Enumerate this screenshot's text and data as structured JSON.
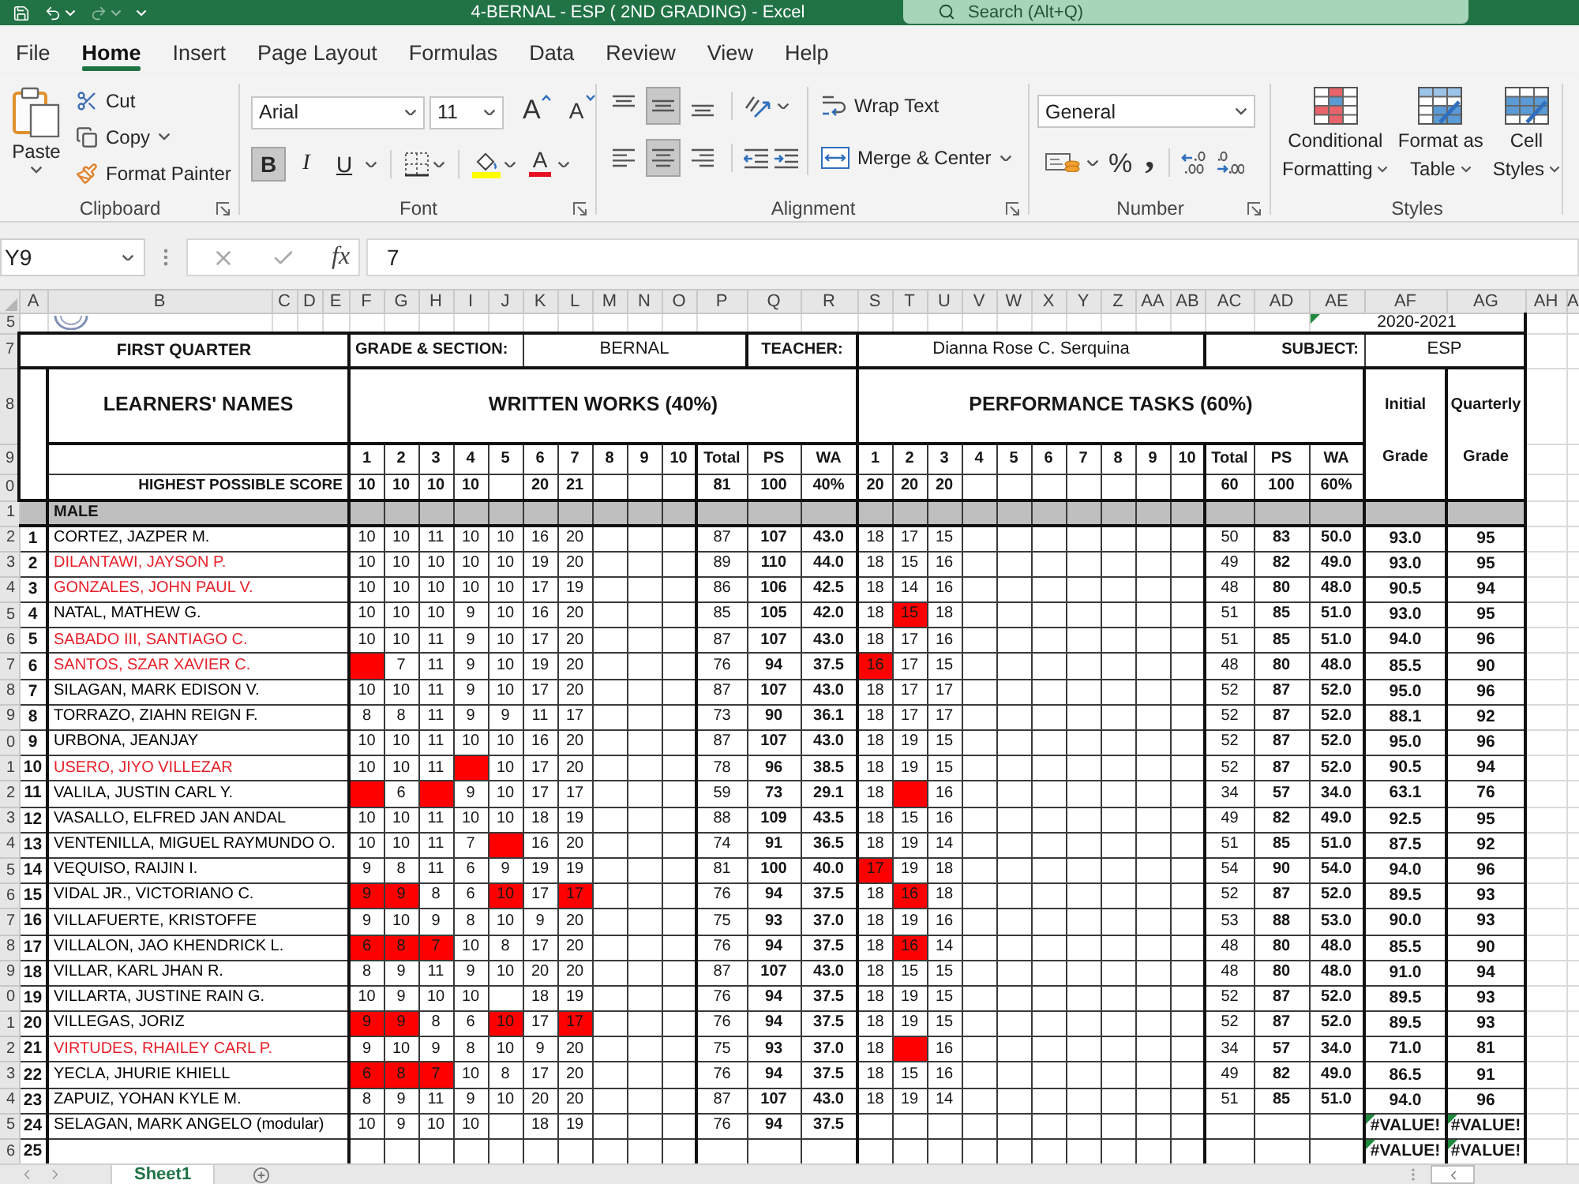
{
  "window": {
    "title": "4-BERNAL - ESP ( 2ND GRADING) - Excel",
    "search": {
      "placeholder": "Search (Alt+Q)"
    }
  },
  "tabs": [
    {
      "label": "File",
      "selected": false
    },
    {
      "label": "Home",
      "selected": true
    },
    {
      "label": "Insert",
      "selected": false
    },
    {
      "label": "Page Layout",
      "selected": false
    },
    {
      "label": "Formulas",
      "selected": false
    },
    {
      "label": "Data",
      "selected": false
    },
    {
      "label": "Review",
      "selected": false
    },
    {
      "label": "View",
      "selected": false
    },
    {
      "label": "Help",
      "selected": false
    }
  ],
  "ribbon": {
    "clipboard": {
      "paste": "Paste",
      "cut": "Cut",
      "copy": "Copy",
      "format_painter": "Format Painter",
      "label": "Clipboard"
    },
    "font": {
      "font_name": "Arial",
      "font_size": "11",
      "grow_font": "A",
      "shrink_font": "A",
      "styles": [
        {
          "kind": "bold",
          "label": "B",
          "selected": true
        },
        {
          "kind": "italic",
          "label": "I",
          "selected": false
        },
        {
          "kind": "underline",
          "label": "U",
          "selected": false
        }
      ],
      "font_color": "A",
      "label": "Font"
    },
    "alignment": {
      "vertical": [
        {
          "kind": "top",
          "selected": false
        },
        {
          "kind": "middle",
          "selected": true
        },
        {
          "kind": "bottom",
          "selected": false
        }
      ],
      "horizontal": [
        {
          "kind": "left",
          "selected": false
        },
        {
          "kind": "center",
          "selected": true
        },
        {
          "kind": "right",
          "selected": false
        }
      ],
      "wrap_text": "Wrap Text",
      "merge_center": "Merge & Center",
      "label": "Alignment"
    },
    "number": {
      "format": "General",
      "percent": "%",
      "comma": ",",
      "label": "Number"
    },
    "styles": {
      "buttons": [
        {
          "kind": "conditional",
          "label": "Conditional Formatting"
        },
        {
          "kind": "table",
          "label": "Format as Table"
        },
        {
          "kind": "cell",
          "label": "Cell Styles"
        }
      ],
      "label": "Styles"
    }
  },
  "formula_bar": {
    "name_box": "Y9",
    "function_label": "fx",
    "formula": "7"
  },
  "sheet": {
    "column_headers": [
      "A",
      "B",
      "C",
      "D",
      "E",
      "F",
      "G",
      "H",
      "I",
      "J",
      "K",
      "L",
      "M",
      "N",
      "O",
      "P",
      "Q",
      "R",
      "S",
      "T",
      "U",
      "V",
      "W",
      "X",
      "Y",
      "Z",
      "AA",
      "AB",
      "AC",
      "AD",
      "AE",
      "AF",
      "AG",
      "AH",
      "A"
    ],
    "row_headers": [
      "5",
      "7",
      "8",
      "9",
      "0",
      "1",
      "2",
      "3",
      "4",
      "5",
      "6",
      "7",
      "8",
      "9",
      "0",
      "1",
      "2",
      "3",
      "4",
      "5",
      "6",
      "7",
      "8",
      "9",
      "0",
      "1",
      "2",
      "3",
      "4",
      "5",
      "6"
    ],
    "school_year": {
      "text": "2020-2021",
      "warning": true
    },
    "quarter": "FIRST QUARTER",
    "grade_section_label": "GRADE & SECTION:",
    "grade_section": "BERNAL",
    "teacher_label": "TEACHER:",
    "teacher": "Dianna Rose C. Serquina",
    "subject_label": "SUBJECT:",
    "subject": "ESP",
    "names_heading": "LEARNERS' NAMES",
    "written": {
      "heading": "WRITTEN WORKS (40%)",
      "items": [
        {
          "label": "1",
          "hps": "10"
        },
        {
          "label": "2",
          "hps": "10"
        },
        {
          "label": "3",
          "hps": "10"
        },
        {
          "label": "4",
          "hps": "10"
        },
        {
          "label": "5"
        },
        {
          "label": "6",
          "hps": "20"
        },
        {
          "label": "7",
          "hps": "21"
        },
        {
          "label": "8"
        },
        {
          "label": "9"
        },
        {
          "label": "10"
        }
      ],
      "summary": [
        "Total",
        "PS",
        "WA"
      ],
      "hps_summary": [
        "81",
        "100",
        "40%"
      ]
    },
    "performance": {
      "heading": "PERFORMANCE TASKS (60%)",
      "items": [
        {
          "label": "1",
          "hps": "20"
        },
        {
          "label": "2",
          "hps": "20"
        },
        {
          "label": "3",
          "hps": "20"
        },
        {
          "label": "4"
        },
        {
          "label": "5"
        },
        {
          "label": "6"
        },
        {
          "label": "7"
        },
        {
          "label": "8"
        },
        {
          "label": "9"
        },
        {
          "label": "10"
        }
      ],
      "summary": [
        "Total",
        "PS",
        "WA"
      ],
      "hps_summary": [
        "60",
        "100",
        "60%"
      ]
    },
    "initial_heading": {
      "top": "Initial",
      "bottom": "Grade"
    },
    "quarterly_heading": {
      "top": "Quarterly",
      "bottom": "Grade"
    },
    "hps_label": "HIGHEST POSSIBLE SCORE",
    "section": "MALE",
    "learners": [
      {
        "no": "1",
        "name": "CORTEZ, JAZPER M.",
        "color": "#000000",
        "written": [
          {
            "score": "10",
            "marked": false
          },
          {
            "score": "10",
            "marked": false
          },
          {
            "score": "11",
            "marked": false
          },
          {
            "score": "10",
            "marked": false
          },
          {
            "score": "10",
            "marked": false
          },
          {
            "score": "16",
            "marked": false
          },
          {
            "score": "20",
            "marked": false
          }
        ],
        "written_summary": [
          "87",
          "107",
          "43.0"
        ],
        "performance": [
          {
            "score": "18",
            "marked": false
          },
          {
            "score": "17",
            "marked": false
          },
          {
            "score": "15",
            "marked": false
          }
        ],
        "performance_summary": [
          "50",
          "83",
          "50.0"
        ],
        "initial": "93.0",
        "quarterly": "95",
        "warning": false
      },
      {
        "no": "2",
        "name": "DILANTAWI, JAYSON P.",
        "color": "#e8202a",
        "written": [
          {
            "score": "10",
            "marked": false
          },
          {
            "score": "10",
            "marked": false
          },
          {
            "score": "10",
            "marked": false
          },
          {
            "score": "10",
            "marked": false
          },
          {
            "score": "10",
            "marked": false
          },
          {
            "score": "19",
            "marked": false
          },
          {
            "score": "20",
            "marked": false
          }
        ],
        "written_summary": [
          "89",
          "110",
          "44.0"
        ],
        "performance": [
          {
            "score": "18",
            "marked": false
          },
          {
            "score": "15",
            "marked": false
          },
          {
            "score": "16",
            "marked": false
          }
        ],
        "performance_summary": [
          "49",
          "82",
          "49.0"
        ],
        "initial": "93.0",
        "quarterly": "95",
        "warning": false
      },
      {
        "no": "3",
        "name": "GONZALES, JOHN PAUL V.",
        "color": "#e8202a",
        "written": [
          {
            "score": "10",
            "marked": false
          },
          {
            "score": "10",
            "marked": false
          },
          {
            "score": "10",
            "marked": false
          },
          {
            "score": "10",
            "marked": false
          },
          {
            "score": "10",
            "marked": false
          },
          {
            "score": "17",
            "marked": false
          },
          {
            "score": "19",
            "marked": false
          }
        ],
        "written_summary": [
          "86",
          "106",
          "42.5"
        ],
        "performance": [
          {
            "score": "18",
            "marked": false
          },
          {
            "score": "14",
            "marked": false
          },
          {
            "score": "16",
            "marked": false
          }
        ],
        "performance_summary": [
          "48",
          "80",
          "48.0"
        ],
        "initial": "90.5",
        "quarterly": "94",
        "warning": false
      },
      {
        "no": "4",
        "name": "NATAL, MATHEW G.",
        "color": "#000000",
        "written": [
          {
            "score": "10",
            "marked": false
          },
          {
            "score": "10",
            "marked": false
          },
          {
            "score": "10",
            "marked": false
          },
          {
            "score": "9",
            "marked": false
          },
          {
            "score": "10",
            "marked": false
          },
          {
            "score": "16",
            "marked": false
          },
          {
            "score": "20",
            "marked": false
          }
        ],
        "written_summary": [
          "85",
          "105",
          "42.0"
        ],
        "performance": [
          {
            "score": "18",
            "marked": false
          },
          {
            "score": "15",
            "marked": true
          },
          {
            "score": "18",
            "marked": false
          }
        ],
        "performance_summary": [
          "51",
          "85",
          "51.0"
        ],
        "initial": "93.0",
        "quarterly": "95",
        "warning": false
      },
      {
        "no": "5",
        "name": "SABADO III, SANTIAGO C.",
        "color": "#e8202a",
        "written": [
          {
            "score": "10",
            "marked": false
          },
          {
            "score": "10",
            "marked": false
          },
          {
            "score": "11",
            "marked": false
          },
          {
            "score": "9",
            "marked": false
          },
          {
            "score": "10",
            "marked": false
          },
          {
            "score": "17",
            "marked": false
          },
          {
            "score": "20",
            "marked": false
          }
        ],
        "written_summary": [
          "87",
          "107",
          "43.0"
        ],
        "performance": [
          {
            "score": "18",
            "marked": false
          },
          {
            "score": "17",
            "marked": false
          },
          {
            "score": "16",
            "marked": false
          }
        ],
        "performance_summary": [
          "51",
          "85",
          "51.0"
        ],
        "initial": "94.0",
        "quarterly": "96",
        "warning": false
      },
      {
        "no": "6",
        "name": "SANTOS, SZAR XAVIER C.",
        "color": "#e8202a",
        "written": [
          {
            "marked": true
          },
          {
            "score": "7",
            "marked": false
          },
          {
            "score": "11",
            "marked": false
          },
          {
            "score": "9",
            "marked": false
          },
          {
            "score": "10",
            "marked": false
          },
          {
            "score": "19",
            "marked": false
          },
          {
            "score": "20",
            "marked": false
          }
        ],
        "written_summary": [
          "76",
          "94",
          "37.5"
        ],
        "performance": [
          {
            "score": "16",
            "marked": true
          },
          {
            "score": "17",
            "marked": false
          },
          {
            "score": "15",
            "marked": false
          }
        ],
        "performance_summary": [
          "48",
          "80",
          "48.0"
        ],
        "initial": "85.5",
        "quarterly": "90",
        "warning": false
      },
      {
        "no": "7",
        "name": "SILAGAN, MARK EDISON V.",
        "color": "#000000",
        "written": [
          {
            "score": "10",
            "marked": false
          },
          {
            "score": "10",
            "marked": false
          },
          {
            "score": "11",
            "marked": false
          },
          {
            "score": "9",
            "marked": false
          },
          {
            "score": "10",
            "marked": false
          },
          {
            "score": "17",
            "marked": false
          },
          {
            "score": "20",
            "marked": false
          }
        ],
        "written_summary": [
          "87",
          "107",
          "43.0"
        ],
        "performance": [
          {
            "score": "18",
            "marked": false
          },
          {
            "score": "17",
            "marked": false
          },
          {
            "score": "17",
            "marked": false
          }
        ],
        "performance_summary": [
          "52",
          "87",
          "52.0"
        ],
        "initial": "95.0",
        "quarterly": "96",
        "warning": false
      },
      {
        "no": "8",
        "name": "TORRAZO, ZIAHN REIGN F.",
        "color": "#000000",
        "written": [
          {
            "score": "8",
            "marked": false
          },
          {
            "score": "8",
            "marked": false
          },
          {
            "score": "11",
            "marked": false
          },
          {
            "score": "9",
            "marked": false
          },
          {
            "score": "9",
            "marked": false
          },
          {
            "score": "11",
            "marked": false
          },
          {
            "score": "17",
            "marked": false
          }
        ],
        "written_summary": [
          "73",
          "90",
          "36.1"
        ],
        "performance": [
          {
            "score": "18",
            "marked": false
          },
          {
            "score": "17",
            "marked": false
          },
          {
            "score": "17",
            "marked": false
          }
        ],
        "performance_summary": [
          "52",
          "87",
          "52.0"
        ],
        "initial": "88.1",
        "quarterly": "92",
        "warning": false
      },
      {
        "no": "9",
        "name": "URBONA, JEANJAY",
        "color": "#000000",
        "written": [
          {
            "score": "10",
            "marked": false
          },
          {
            "score": "10",
            "marked": false
          },
          {
            "score": "11",
            "marked": false
          },
          {
            "score": "10",
            "marked": false
          },
          {
            "score": "10",
            "marked": false
          },
          {
            "score": "16",
            "marked": false
          },
          {
            "score": "20",
            "marked": false
          }
        ],
        "written_summary": [
          "87",
          "107",
          "43.0"
        ],
        "performance": [
          {
            "score": "18",
            "marked": false
          },
          {
            "score": "19",
            "marked": false
          },
          {
            "score": "15",
            "marked": false
          }
        ],
        "performance_summary": [
          "52",
          "87",
          "52.0"
        ],
        "initial": "95.0",
        "quarterly": "96",
        "warning": false
      },
      {
        "no": "10",
        "name": "USERO, JIYO VILLEZAR",
        "color": "#e8202a",
        "written": [
          {
            "score": "10",
            "marked": false
          },
          {
            "score": "10",
            "marked": false
          },
          {
            "score": "11",
            "marked": false
          },
          {
            "marked": true
          },
          {
            "score": "10",
            "marked": false
          },
          {
            "score": "17",
            "marked": false
          },
          {
            "score": "20",
            "marked": false
          }
        ],
        "written_summary": [
          "78",
          "96",
          "38.5"
        ],
        "performance": [
          {
            "score": "18",
            "marked": false
          },
          {
            "score": "19",
            "marked": false
          },
          {
            "score": "15",
            "marked": false
          }
        ],
        "performance_summary": [
          "52",
          "87",
          "52.0"
        ],
        "initial": "90.5",
        "quarterly": "94",
        "warning": false
      },
      {
        "no": "11",
        "name": "VALILA, JUSTIN CARL Y.",
        "color": "#000000",
        "written": [
          {
            "marked": true
          },
          {
            "score": "6",
            "marked": false
          },
          {
            "marked": true
          },
          {
            "score": "9",
            "marked": false
          },
          {
            "score": "10",
            "marked": false
          },
          {
            "score": "17",
            "marked": false
          },
          {
            "score": "17",
            "marked": false
          }
        ],
        "written_summary": [
          "59",
          "73",
          "29.1"
        ],
        "performance": [
          {
            "score": "18",
            "marked": false
          },
          {
            "marked": true
          },
          {
            "score": "16",
            "marked": false
          }
        ],
        "performance_summary": [
          "34",
          "57",
          "34.0"
        ],
        "initial": "63.1",
        "quarterly": "76",
        "warning": false
      },
      {
        "no": "12",
        "name": "VASALLO, ELFRED JAN ANDAL",
        "color": "#000000",
        "written": [
          {
            "score": "10",
            "marked": false
          },
          {
            "score": "10",
            "marked": false
          },
          {
            "score": "11",
            "marked": false
          },
          {
            "score": "10",
            "marked": false
          },
          {
            "score": "10",
            "marked": false
          },
          {
            "score": "18",
            "marked": false
          },
          {
            "score": "19",
            "marked": false
          }
        ],
        "written_summary": [
          "88",
          "109",
          "43.5"
        ],
        "performance": [
          {
            "score": "18",
            "marked": false
          },
          {
            "score": "15",
            "marked": false
          },
          {
            "score": "16",
            "marked": false
          }
        ],
        "performance_summary": [
          "49",
          "82",
          "49.0"
        ],
        "initial": "92.5",
        "quarterly": "95",
        "warning": false
      },
      {
        "no": "13",
        "name": "VENTENILLA, MIGUEL RAYMUNDO O.",
        "color": "#000000",
        "written": [
          {
            "score": "10",
            "marked": false
          },
          {
            "score": "10",
            "marked": false
          },
          {
            "score": "11",
            "marked": false
          },
          {
            "score": "7",
            "marked": false
          },
          {
            "marked": true
          },
          {
            "score": "16",
            "marked": false
          },
          {
            "score": "20",
            "marked": false
          }
        ],
        "written_summary": [
          "74",
          "91",
          "36.5"
        ],
        "performance": [
          {
            "score": "18",
            "marked": false
          },
          {
            "score": "19",
            "marked": false
          },
          {
            "score": "14",
            "marked": false
          }
        ],
        "performance_summary": [
          "51",
          "85",
          "51.0"
        ],
        "initial": "87.5",
        "quarterly": "92",
        "warning": false
      },
      {
        "no": "14",
        "name": "VEQUISO, RAIJIN I.",
        "color": "#000000",
        "written": [
          {
            "score": "9",
            "marked": false
          },
          {
            "score": "8",
            "marked": false
          },
          {
            "score": "11",
            "marked": false
          },
          {
            "score": "6",
            "marked": false
          },
          {
            "score": "9",
            "marked": false
          },
          {
            "score": "19",
            "marked": false
          },
          {
            "score": "19",
            "marked": false
          }
        ],
        "written_summary": [
          "81",
          "100",
          "40.0"
        ],
        "performance": [
          {
            "score": "17",
            "marked": true
          },
          {
            "score": "19",
            "marked": false
          },
          {
            "score": "18",
            "marked": false
          }
        ],
        "performance_summary": [
          "54",
          "90",
          "54.0"
        ],
        "initial": "94.0",
        "quarterly": "96",
        "warning": false
      },
      {
        "no": "15",
        "name": "VIDAL JR., VICTORIANO C.",
        "color": "#000000",
        "written": [
          {
            "score": "9",
            "marked": true
          },
          {
            "score": "9",
            "marked": true
          },
          {
            "score": "8",
            "marked": false
          },
          {
            "score": "6",
            "marked": false
          },
          {
            "score": "10",
            "marked": true
          },
          {
            "score": "17",
            "marked": false
          },
          {
            "score": "17",
            "marked": true
          }
        ],
        "written_summary": [
          "76",
          "94",
          "37.5"
        ],
        "performance": [
          {
            "score": "18",
            "marked": false
          },
          {
            "score": "16",
            "marked": true
          },
          {
            "score": "18",
            "marked": false
          }
        ],
        "performance_summary": [
          "52",
          "87",
          "52.0"
        ],
        "initial": "89.5",
        "quarterly": "93",
        "warning": false
      },
      {
        "no": "16",
        "name": "VILLAFUERTE, KRISTOFFE",
        "color": "#000000",
        "written": [
          {
            "score": "9",
            "marked": false
          },
          {
            "score": "10",
            "marked": false
          },
          {
            "score": "9",
            "marked": false
          },
          {
            "score": "8",
            "marked": false
          },
          {
            "score": "10",
            "marked": false
          },
          {
            "score": "9",
            "marked": false
          },
          {
            "score": "20",
            "marked": false
          }
        ],
        "written_summary": [
          "75",
          "93",
          "37.0"
        ],
        "performance": [
          {
            "score": "18",
            "marked": false
          },
          {
            "score": "19",
            "marked": false
          },
          {
            "score": "16",
            "marked": false
          }
        ],
        "performance_summary": [
          "53",
          "88",
          "53.0"
        ],
        "initial": "90.0",
        "quarterly": "93",
        "warning": false
      },
      {
        "no": "17",
        "name": "VILLALON, JAO KHENDRICK L.",
        "color": "#000000",
        "written": [
          {
            "score": "6",
            "marked": true
          },
          {
            "score": "8",
            "marked": true
          },
          {
            "score": "7",
            "marked": true
          },
          {
            "score": "10",
            "marked": false
          },
          {
            "score": "8",
            "marked": false
          },
          {
            "score": "17",
            "marked": false
          },
          {
            "score": "20",
            "marked": false
          }
        ],
        "written_summary": [
          "76",
          "94",
          "37.5"
        ],
        "performance": [
          {
            "score": "18",
            "marked": false
          },
          {
            "score": "16",
            "marked": true
          },
          {
            "score": "14",
            "marked": false
          }
        ],
        "performance_summary": [
          "48",
          "80",
          "48.0"
        ],
        "initial": "85.5",
        "quarterly": "90",
        "warning": false
      },
      {
        "no": "18",
        "name": "VILLAR, KARL JHAN R.",
        "color": "#000000",
        "written": [
          {
            "score": "8",
            "marked": false
          },
          {
            "score": "9",
            "marked": false
          },
          {
            "score": "11",
            "marked": false
          },
          {
            "score": "9",
            "marked": false
          },
          {
            "score": "10",
            "marked": false
          },
          {
            "score": "20",
            "marked": false
          },
          {
            "score": "20",
            "marked": false
          }
        ],
        "written_summary": [
          "87",
          "107",
          "43.0"
        ],
        "performance": [
          {
            "score": "18",
            "marked": false
          },
          {
            "score": "15",
            "marked": false
          },
          {
            "score": "15",
            "marked": false
          }
        ],
        "performance_summary": [
          "48",
          "80",
          "48.0"
        ],
        "initial": "91.0",
        "quarterly": "94",
        "warning": false
      },
      {
        "no": "19",
        "name": "VILLARTA, JUSTINE RAIN G.",
        "color": "#000000",
        "written": [
          {
            "score": "10",
            "marked": false
          },
          {
            "score": "9",
            "marked": false
          },
          {
            "score": "10",
            "marked": false
          },
          {
            "score": "10",
            "marked": false
          },
          {
            "marked": false
          },
          {
            "score": "18",
            "marked": false
          },
          {
            "score": "19",
            "marked": false
          }
        ],
        "written_summary": [
          "76",
          "94",
          "37.5"
        ],
        "performance": [
          {
            "score": "18",
            "marked": false
          },
          {
            "score": "19",
            "marked": false
          },
          {
            "score": "15",
            "marked": false
          }
        ],
        "performance_summary": [
          "52",
          "87",
          "52.0"
        ],
        "initial": "89.5",
        "quarterly": "93",
        "warning": false
      },
      {
        "no": "20",
        "name": "VILLEGAS, JORIZ",
        "color": "#000000",
        "written": [
          {
            "score": "9",
            "marked": true
          },
          {
            "score": "9",
            "marked": true
          },
          {
            "score": "8",
            "marked": false
          },
          {
            "score": "6",
            "marked": false
          },
          {
            "score": "10",
            "marked": true
          },
          {
            "score": "17",
            "marked": false
          },
          {
            "score": "17",
            "marked": true
          }
        ],
        "written_summary": [
          "76",
          "94",
          "37.5"
        ],
        "performance": [
          {
            "score": "18",
            "marked": false
          },
          {
            "score": "19",
            "marked": false
          },
          {
            "score": "15",
            "marked": false
          }
        ],
        "performance_summary": [
          "52",
          "87",
          "52.0"
        ],
        "initial": "89.5",
        "quarterly": "93",
        "warning": false
      },
      {
        "no": "21",
        "name": "VIRTUDES, RHAILEY CARL P.",
        "color": "#e8202a",
        "written": [
          {
            "score": "9",
            "marked": false
          },
          {
            "score": "10",
            "marked": false
          },
          {
            "score": "9",
            "marked": false
          },
          {
            "score": "8",
            "marked": false
          },
          {
            "score": "10",
            "marked": false
          },
          {
            "score": "9",
            "marked": false
          },
          {
            "score": "20",
            "marked": false
          }
        ],
        "written_summary": [
          "75",
          "93",
          "37.0"
        ],
        "performance": [
          {
            "score": "18",
            "marked": false
          },
          {
            "marked": true
          },
          {
            "score": "16",
            "marked": false
          }
        ],
        "performance_summary": [
          "34",
          "57",
          "34.0"
        ],
        "initial": "71.0",
        "quarterly": "81",
        "warning": false
      },
      {
        "no": "22",
        "name": "YECLA, JHURIE KHIELL",
        "color": "#000000",
        "written": [
          {
            "score": "6",
            "marked": true
          },
          {
            "score": "8",
            "marked": true
          },
          {
            "score": "7",
            "marked": true
          },
          {
            "score": "10",
            "marked": false
          },
          {
            "score": "8",
            "marked": false
          },
          {
            "score": "17",
            "marked": false
          },
          {
            "score": "20",
            "marked": false
          }
        ],
        "written_summary": [
          "76",
          "94",
          "37.5"
        ],
        "performance": [
          {
            "score": "18",
            "marked": false
          },
          {
            "score": "15",
            "marked": false
          },
          {
            "score": "16",
            "marked": false
          }
        ],
        "performance_summary": [
          "49",
          "82",
          "49.0"
        ],
        "initial": "86.5",
        "quarterly": "91",
        "warning": false
      },
      {
        "no": "23",
        "name": "ZAPUIZ, YOHAN KYLE M.",
        "color": "#000000",
        "written": [
          {
            "score": "8",
            "marked": false
          },
          {
            "score": "9",
            "marked": false
          },
          {
            "score": "11",
            "marked": false
          },
          {
            "score": "9",
            "marked": false
          },
          {
            "score": "10",
            "marked": false
          },
          {
            "score": "20",
            "marked": false
          },
          {
            "score": "20",
            "marked": false
          }
        ],
        "written_summary": [
          "87",
          "107",
          "43.0"
        ],
        "performance": [
          {
            "score": "18",
            "marked": false
          },
          {
            "score": "19",
            "marked": false
          },
          {
            "score": "14",
            "marked": false
          }
        ],
        "performance_summary": [
          "51",
          "85",
          "51.0"
        ],
        "initial": "94.0",
        "quarterly": "96",
        "warning": false
      },
      {
        "no": "24",
        "name": "SELAGAN, MARK ANGELO (modular)",
        "color": "#000000",
        "written": [
          {
            "score": "10",
            "marked": false
          },
          {
            "score": "9",
            "marked": false
          },
          {
            "score": "10",
            "marked": false
          },
          {
            "score": "10",
            "marked": false
          },
          {
            "marked": false
          },
          {
            "score": "18",
            "marked": false
          },
          {
            "score": "19",
            "marked": false
          }
        ],
        "written_summary": [
          "76",
          "94",
          "37.5"
        ],
        "initial": "#VALUE!",
        "quarterly": "#VALUE!",
        "warning": true
      },
      {
        "no": "25",
        "initial": "#VALUE!",
        "quarterly": "#VALUE!",
        "warning": true
      }
    ]
  },
  "sheet_tabs": [
    {
      "label": "Sheet1",
      "selected": true
    }
  ]
}
